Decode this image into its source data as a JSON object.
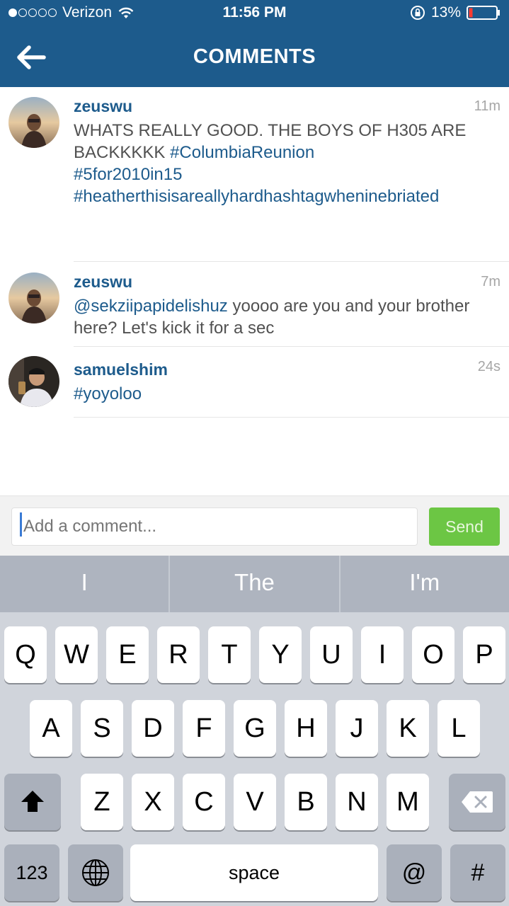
{
  "status_bar": {
    "carrier": "Verizon",
    "time": "11:56 PM",
    "battery": "13%",
    "signal_bars_filled": 1,
    "signal_bars_total": 5
  },
  "header": {
    "title": "COMMENTS"
  },
  "comments": [
    {
      "username": "zeuswu",
      "time": "11m",
      "text_plain": "WHATS REALLY GOOD. THE BOYS OF H305 ARE BACKKKKK ",
      "hashtag1": "#ColumbiaReunion",
      "hashtag2": "#5for2010in15",
      "hashtag3": "#heatherthisisareallyhardhashtagwheninebriated"
    },
    {
      "username": "zeuswu",
      "time": "7m",
      "mention": "@sekziipapidelishuz",
      "text_plain": " yoooo are you and your brother here? Let's kick it for a sec"
    },
    {
      "username": "samuelshim",
      "time": "24s",
      "hashtag1": "#yoyoloo"
    }
  ],
  "composer": {
    "placeholder": "Add a comment...",
    "send_label": "Send"
  },
  "suggestions": [
    "I",
    "The",
    "I'm"
  ],
  "keyboard": {
    "row1": [
      "Q",
      "W",
      "E",
      "R",
      "T",
      "Y",
      "U",
      "I",
      "O",
      "P"
    ],
    "row2": [
      "A",
      "S",
      "D",
      "F",
      "G",
      "H",
      "J",
      "K",
      "L"
    ],
    "row3": [
      "Z",
      "X",
      "C",
      "V",
      "B",
      "N",
      "M"
    ],
    "numbers_label": "123",
    "space_label": "space",
    "at_label": "@",
    "hash_label": "#"
  },
  "colors": {
    "header_bg": "#1d5b8c",
    "link": "#1d5b8c",
    "send_bg": "#6cc644"
  }
}
